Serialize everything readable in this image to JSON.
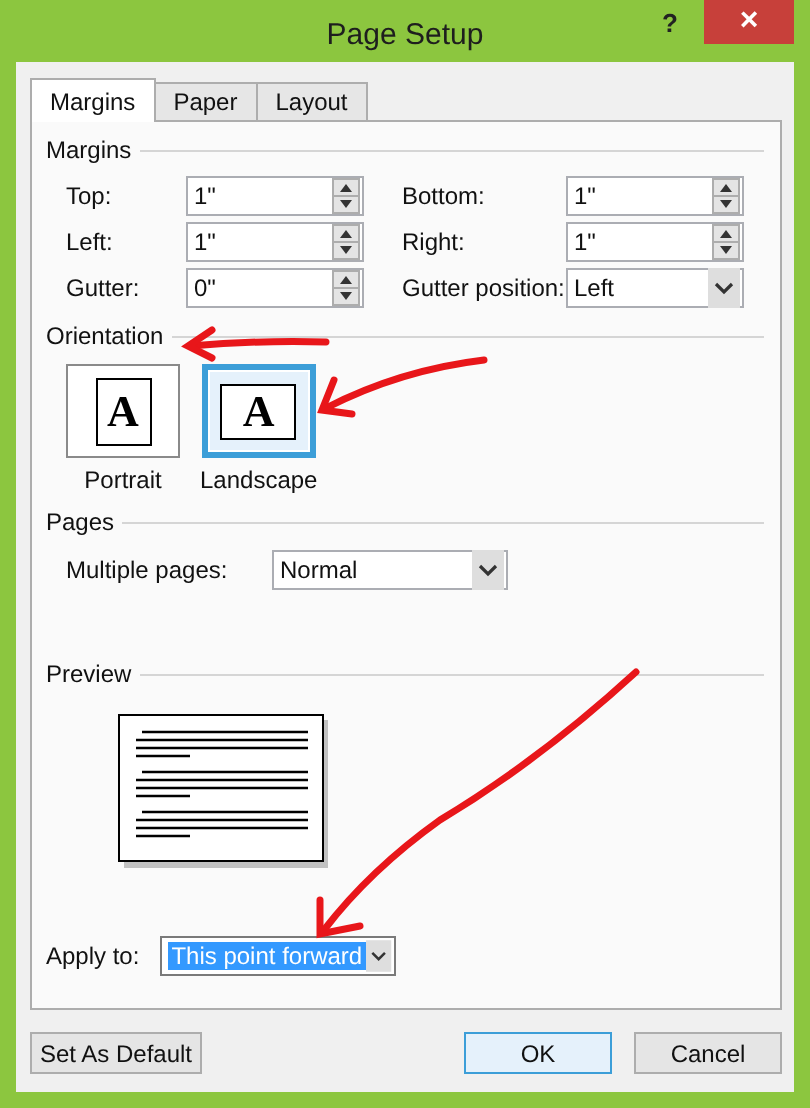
{
  "window": {
    "title": "Page Setup",
    "help": "?",
    "close": "×"
  },
  "tabs": [
    {
      "label": "Margins",
      "selected": true
    },
    {
      "label": "Paper",
      "selected": false
    },
    {
      "label": "Layout",
      "selected": false
    }
  ],
  "margins": {
    "heading": "Margins",
    "fields": [
      {
        "label": "Top:",
        "value": "1\"",
        "kind": "spin"
      },
      {
        "label": "Bottom:",
        "value": "1\"",
        "kind": "spin"
      },
      {
        "label": "Left:",
        "value": "1\"",
        "kind": "spin"
      },
      {
        "label": "Right:",
        "value": "1\"",
        "kind": "spin"
      },
      {
        "label": "Gutter:",
        "value": "0\"",
        "kind": "spin"
      },
      {
        "label": "Gutter position:",
        "value": "Left",
        "kind": "dropdown"
      }
    ]
  },
  "orientation": {
    "heading": "Orientation",
    "options": [
      {
        "label": "Portrait",
        "glyph": "A",
        "kind": "portrait",
        "selected": false
      },
      {
        "label": "Landscape",
        "glyph": "A",
        "kind": "landscape",
        "selected": true
      }
    ]
  },
  "pages": {
    "heading": "Pages",
    "label": "Multiple pages:",
    "value": "Normal"
  },
  "preview": {
    "heading": "Preview"
  },
  "apply": {
    "label": "Apply to:",
    "value": "This point forward"
  },
  "buttons": [
    {
      "label": "Set As Default",
      "kind": "left"
    },
    {
      "label": "OK",
      "kind": "default"
    },
    {
      "label": "Cancel",
      "kind": "normal"
    }
  ]
}
